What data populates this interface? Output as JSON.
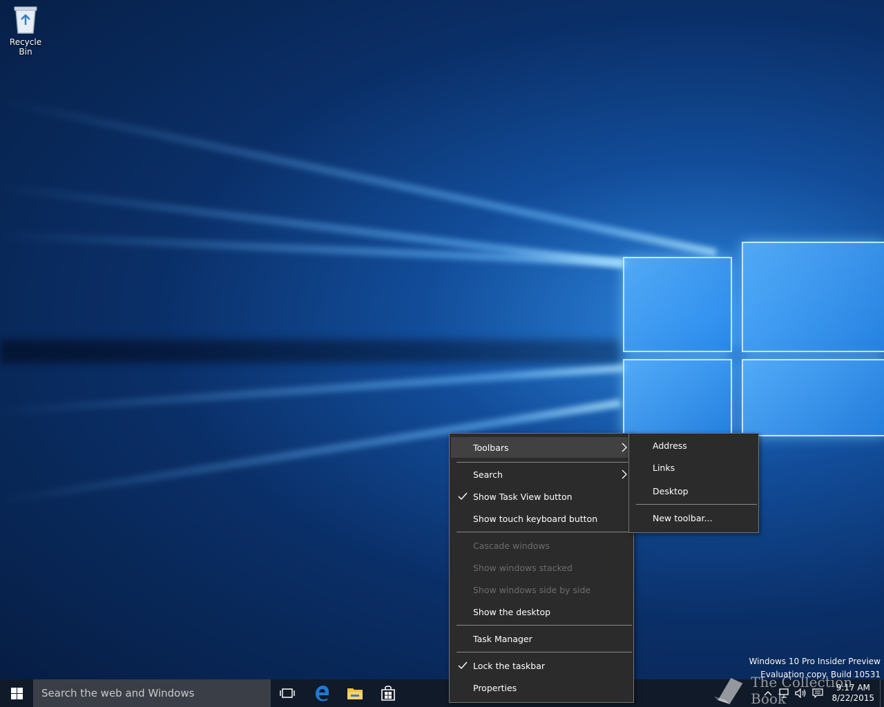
{
  "desktop": {
    "recycle_bin_label": "Recycle Bin",
    "watermark_line1": "Windows 10 Pro Insider Preview",
    "watermark_line2": "Evaluation copy. Build 10531",
    "site_watermark": "The Collection Book"
  },
  "taskbar": {
    "search_placeholder": "Search the web and Windows",
    "pinned": [
      "task-view",
      "edge",
      "file-explorer",
      "store"
    ],
    "clock_time": "9:17 AM",
    "clock_date": "8/22/2015"
  },
  "context_menu": {
    "toolbars": "Toolbars",
    "search": "Search",
    "show_task_view": "Show Task View button",
    "show_touch_keyboard": "Show touch keyboard button",
    "cascade": "Cascade windows",
    "stacked": "Show windows stacked",
    "side_by_side": "Show windows side by side",
    "show_desktop": "Show the desktop",
    "task_manager": "Task Manager",
    "lock_taskbar": "Lock the taskbar",
    "properties": "Properties"
  },
  "toolbars_submenu": {
    "address": "Address",
    "links": "Links",
    "desktop": "Desktop",
    "new_toolbar": "New toolbar..."
  },
  "colors": {
    "menu_bg": "#2b2b2b",
    "menu_hover": "#414141",
    "taskbar_bg": "#101a28",
    "edge_blue": "#1e78d7",
    "explorer_yellow": "#f3c242"
  }
}
